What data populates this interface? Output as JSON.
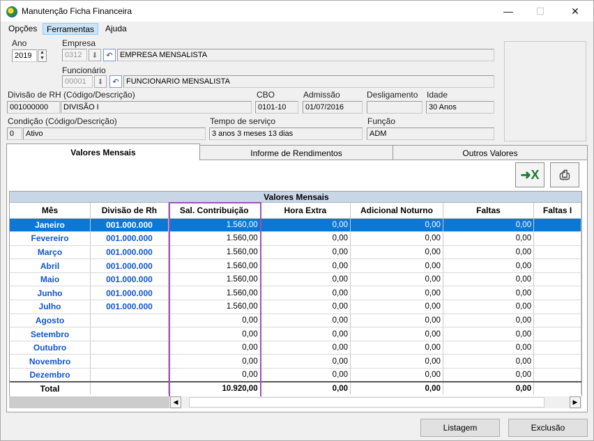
{
  "window": {
    "title": "Manutenção Ficha Financeira",
    "minimize": "—",
    "maximize": "☐",
    "close": "✕"
  },
  "menu": [
    "Opções",
    "Ferramentas",
    "Ajuda"
  ],
  "header": {
    "ano_label": "Ano",
    "ano_value": "2019",
    "empresa_label": "Empresa",
    "empresa_code": "0312",
    "empresa_name": "EMPRESA MENSALISTA",
    "funcionario_label": "Funcionário",
    "funcionario_code": "00001",
    "funcionario_name": "FUNCIONARIO MENSALISTA",
    "divisao_label": "Divisão de RH (Código/Descrição)",
    "divisao_code": "001000000",
    "divisao_desc": "DIVISÃO I",
    "cbo_label": "CBO",
    "cbo_value": "0101-10",
    "admissao_label": "Admissão",
    "admissao_value": "01/07/2016",
    "desligamento_label": "Desligamento",
    "desligamento_value": "",
    "idade_label": "Idade",
    "idade_value": "30 Anos",
    "condicao_label": "Condição (Código/Descrição)",
    "condicao_code": "0",
    "condicao_desc": "Ativo",
    "tempo_label": "Tempo de serviço",
    "tempo_value": "3 anos 3 meses 13 dias",
    "funcao_label": "Função",
    "funcao_value": "ADM"
  },
  "tabs": [
    "Valores Mensais",
    "Informe de Rendimentos",
    "Outros Valores"
  ],
  "grid": {
    "title": "Valores Mensais",
    "columns": [
      "Mês",
      "Divisão de Rh",
      "Sal. Contribuição",
      "Hora Extra",
      "Adicional Noturno",
      "Faltas",
      "Faltas I"
    ],
    "rows": [
      {
        "mes": "Janeiro",
        "div": "001.000.000",
        "sal": "1.560,00",
        "he": "0,00",
        "an": "0,00",
        "f": "0,00"
      },
      {
        "mes": "Fevereiro",
        "div": "001.000.000",
        "sal": "1.560,00",
        "he": "0,00",
        "an": "0,00",
        "f": "0,00"
      },
      {
        "mes": "Março",
        "div": "001.000.000",
        "sal": "1.560,00",
        "he": "0,00",
        "an": "0,00",
        "f": "0,00"
      },
      {
        "mes": "Abril",
        "div": "001.000.000",
        "sal": "1.560,00",
        "he": "0,00",
        "an": "0,00",
        "f": "0,00"
      },
      {
        "mes": "Maio",
        "div": "001.000.000",
        "sal": "1.560,00",
        "he": "0,00",
        "an": "0,00",
        "f": "0,00"
      },
      {
        "mes": "Junho",
        "div": "001.000.000",
        "sal": "1.560,00",
        "he": "0,00",
        "an": "0,00",
        "f": "0,00"
      },
      {
        "mes": "Julho",
        "div": "001.000.000",
        "sal": "1.560,00",
        "he": "0,00",
        "an": "0,00",
        "f": "0,00"
      },
      {
        "mes": "Agosto",
        "div": "",
        "sal": "0,00",
        "he": "0,00",
        "an": "0,00",
        "f": "0,00"
      },
      {
        "mes": "Setembro",
        "div": "",
        "sal": "0,00",
        "he": "0,00",
        "an": "0,00",
        "f": "0,00"
      },
      {
        "mes": "Outubro",
        "div": "",
        "sal": "0,00",
        "he": "0,00",
        "an": "0,00",
        "f": "0,00"
      },
      {
        "mes": "Novembro",
        "div": "",
        "sal": "0,00",
        "he": "0,00",
        "an": "0,00",
        "f": "0,00"
      },
      {
        "mes": "Dezembro",
        "div": "",
        "sal": "0,00",
        "he": "0,00",
        "an": "0,00",
        "f": "0,00"
      }
    ],
    "total": {
      "label": "Total",
      "sal": "10.920,00",
      "he": "0,00",
      "an": "0,00",
      "f": "0,00"
    }
  },
  "buttons": {
    "listagem": "Listagem",
    "exclusao": "Exclusão"
  },
  "icons": {
    "export": "export-excel-icon",
    "print": "printer-icon"
  },
  "colors": {
    "selected_row": "#0a78d7",
    "month_text": "#1155cc",
    "highlight_border": "#a14fbd"
  }
}
